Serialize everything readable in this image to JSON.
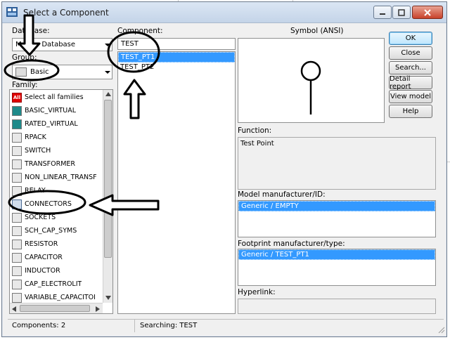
{
  "window": {
    "title": "Select a Component",
    "minimize_icon": "minimize-icon",
    "maximize_icon": "maximize-icon",
    "close_icon": "close-icon"
  },
  "database": {
    "label": "Database:",
    "value": "Master Database"
  },
  "group": {
    "label": "Group:",
    "value": "Basic"
  },
  "family": {
    "label": "Family:",
    "items": [
      {
        "label": "Select all families",
        "icon": "all-families-icon"
      },
      {
        "label": "BASIC_VIRTUAL",
        "icon": "basic-virtual-icon"
      },
      {
        "label": "RATED_VIRTUAL",
        "icon": "rated-virtual-icon"
      },
      {
        "label": "RPACK",
        "icon": "rpack-icon"
      },
      {
        "label": "SWITCH",
        "icon": "switch-icon"
      },
      {
        "label": "TRANSFORMER",
        "icon": "transformer-icon"
      },
      {
        "label": "NON_LINEAR_TRANSF",
        "icon": "non-linear-transformer-icon"
      },
      {
        "label": "RELAY",
        "icon": "relay-icon"
      },
      {
        "label": "CONNECTORS",
        "icon": "connectors-icon"
      },
      {
        "label": "SOCKETS",
        "icon": "sockets-icon"
      },
      {
        "label": "SCH_CAP_SYMS",
        "icon": "sch-cap-syms-icon"
      },
      {
        "label": "RESISTOR",
        "icon": "resistor-icon"
      },
      {
        "label": "CAPACITOR",
        "icon": "capacitor-icon"
      },
      {
        "label": "INDUCTOR",
        "icon": "inductor-icon"
      },
      {
        "label": "CAP_ELECTROLIT",
        "icon": "cap-electrolit-icon"
      },
      {
        "label": "VARIABLE_CAPACITOI",
        "icon": "variable-capacitor-icon"
      }
    ],
    "all_icon_text": "All"
  },
  "component": {
    "label": "Component:",
    "search_value": "TEST",
    "items": [
      "TEST_PT1",
      "TEST_PT2"
    ]
  },
  "symbol": {
    "label": "Symbol (ANSI)"
  },
  "function": {
    "label": "Function:",
    "value": "Test Point"
  },
  "model": {
    "label": "Model manufacturer/ID:",
    "value": "Generic / EMPTY"
  },
  "footprint": {
    "label": "Footprint manufacturer/type:",
    "value": "Generic / TEST_PT1"
  },
  "hyperlink": {
    "label": "Hyperlink:"
  },
  "buttons": {
    "ok": "OK",
    "close": "Close",
    "search": "Search...",
    "detail_report": "Detail report",
    "view_model": "View model",
    "help": "Help"
  },
  "status": {
    "components": "Components: 2",
    "searching": "Searching: TEST"
  },
  "colors": {
    "selection": "#3399ff",
    "window_bg": "#f0f0f0",
    "titlebar": "#c4d4e8",
    "annotation": "#000000"
  }
}
